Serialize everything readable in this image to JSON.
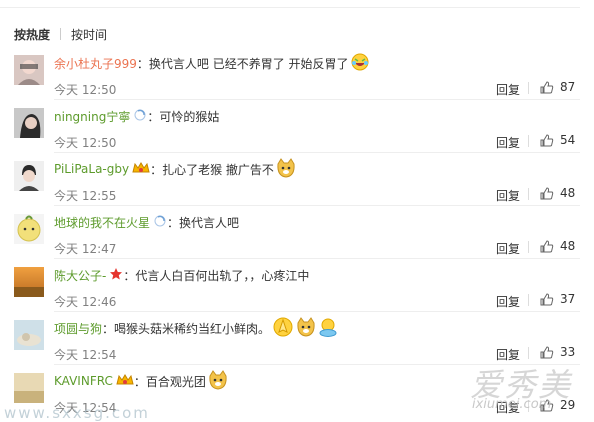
{
  "sort": {
    "hot": "按热度",
    "time": "按时间"
  },
  "actions": {
    "reply": "回复"
  },
  "comments": [
    {
      "name": "余小杜丸子999",
      "colon": "：",
      "text": "换代言人吧 已经不养胃了 开始反胃了",
      "time": "今天 12:50",
      "likes": "87",
      "name_color": "#eb7350"
    },
    {
      "name": "ningning宁寧",
      "colon": "：",
      "text": "可怜的猴姑",
      "time": "今天 12:50",
      "likes": "54"
    },
    {
      "name": "PiLiPaLa-gby",
      "colon": "：",
      "text": "扎心了老猴 撤广告不",
      "time": "今天 12:55",
      "likes": "48"
    },
    {
      "name": "地球的我不在火星",
      "colon": "：",
      "text": "换代言人吧",
      "time": "今天 12:47",
      "likes": "48"
    },
    {
      "name": "陈大公子-",
      "colon": "：",
      "text": "代言人白百何出轨了，，心疼江中",
      "time": "今天 12:46",
      "likes": "37"
    },
    {
      "name": "项圆与狗",
      "colon": "：",
      "text": "喝猴头菇米稀约当红小鲜肉。",
      "time": "今天 12:54",
      "likes": "33"
    },
    {
      "name": "KAVINFRC",
      "colon": "：",
      "text": "百合观光团",
      "time": "今天 12:54",
      "likes": "29"
    }
  ],
  "watermark": {
    "site_cn": "爱秀美",
    "site_url": "ixiumei.com",
    "left_url": "www.sxxsg.com"
  },
  "colors": {
    "username": "#5d9b2c",
    "username_vip": "#eb7350",
    "meta": "#808080",
    "divider": "#eeeeee"
  }
}
